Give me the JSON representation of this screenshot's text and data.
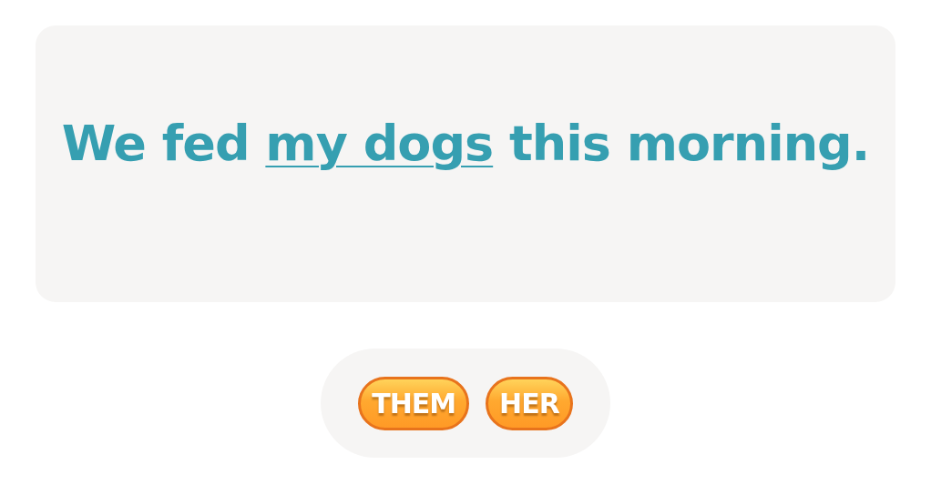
{
  "sentence": {
    "before": "We fed ",
    "underlined": "my dogs",
    "after": " this morning."
  },
  "choices": [
    {
      "label": "THEM"
    },
    {
      "label": "HER"
    }
  ]
}
